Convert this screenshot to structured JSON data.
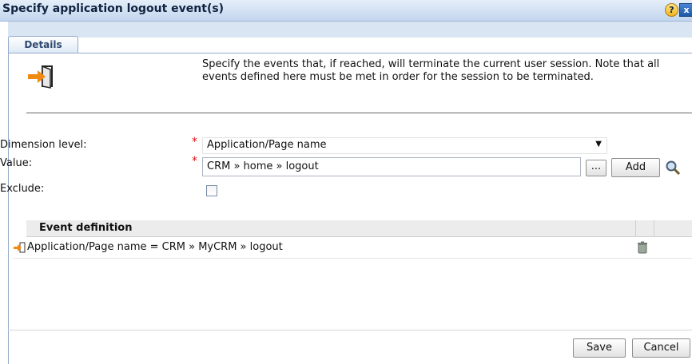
{
  "window": {
    "title": "Specify application logout event(s)",
    "help_glyph": "?",
    "close_glyph": "x"
  },
  "tabs": [
    {
      "label": "Details"
    }
  ],
  "description": "Specify the events that, if reached, will terminate the current user session. Note that all events defined here must be met in order for the session to be terminated.",
  "form": {
    "dimension_label": "Dimension level:",
    "dimension_value": "Application/Page name",
    "value_label": "Value:",
    "value_text": "CRM » home » logout",
    "browse_label": "...",
    "add_label": "Add",
    "exclude_label": "Exclude:",
    "exclude_checked": false,
    "required_marker": "*"
  },
  "grid": {
    "header": "Event definition",
    "rows": [
      {
        "text": "Application/Page name = CRM » MyCRM » logout"
      }
    ]
  },
  "footer": {
    "save_label": "Save",
    "cancel_label": "Cancel"
  },
  "colors": {
    "accent": "#c3d6ee",
    "arrow": "#f08a12",
    "required": "#dd1111"
  },
  "icons": [
    "logout-arrow-icon",
    "help-icon",
    "close-icon",
    "search-icon",
    "trash-icon",
    "dropdown-caret-icon"
  ]
}
